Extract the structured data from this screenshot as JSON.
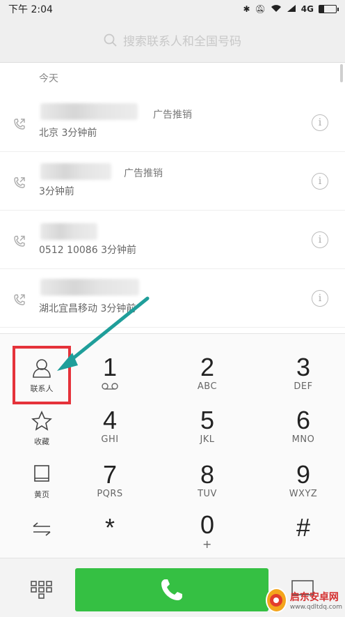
{
  "status_bar": {
    "time": "下午 2:04",
    "network": "4G",
    "battery_level": 0.3
  },
  "search": {
    "placeholder": "搜索联系人和全国号码"
  },
  "call_log": {
    "section_title": "今天",
    "entries": [
      {
        "tag": "广告推销",
        "detail": "北京 3分钟前"
      },
      {
        "tag": "广告推销",
        "detail": "3分钟前"
      },
      {
        "tag": "",
        "detail": "0512 10086 3分钟前"
      },
      {
        "tag": "",
        "detail": "湖北宜昌移动 3分钟前"
      }
    ]
  },
  "side_buttons": [
    {
      "label": "联系人",
      "icon": "person-icon"
    },
    {
      "label": "收藏",
      "icon": "star-icon"
    },
    {
      "label": "黄页",
      "icon": "book-icon"
    },
    {
      "label": "",
      "icon": "swap-icon"
    }
  ],
  "keys": [
    {
      "digit": "1",
      "letters": "voicemail-icon"
    },
    {
      "digit": "2",
      "letters": "ABC"
    },
    {
      "digit": "3",
      "letters": "DEF"
    },
    {
      "digit": "4",
      "letters": "GHI"
    },
    {
      "digit": "5",
      "letters": "JKL"
    },
    {
      "digit": "6",
      "letters": "MNO"
    },
    {
      "digit": "7",
      "letters": "PQRS"
    },
    {
      "digit": "8",
      "letters": "TUV"
    },
    {
      "digit": "9",
      "letters": "WXYZ"
    },
    {
      "digit": "*",
      "letters": ""
    },
    {
      "digit": "0",
      "letters": "+"
    },
    {
      "digit": "#",
      "letters": ""
    }
  ],
  "colors": {
    "call_button": "#35c043",
    "highlight": "#e5323a",
    "arrow": "#1f9e9a"
  },
  "watermark": {
    "title": "启东安卓网",
    "url": "www.qdltdq.com"
  }
}
